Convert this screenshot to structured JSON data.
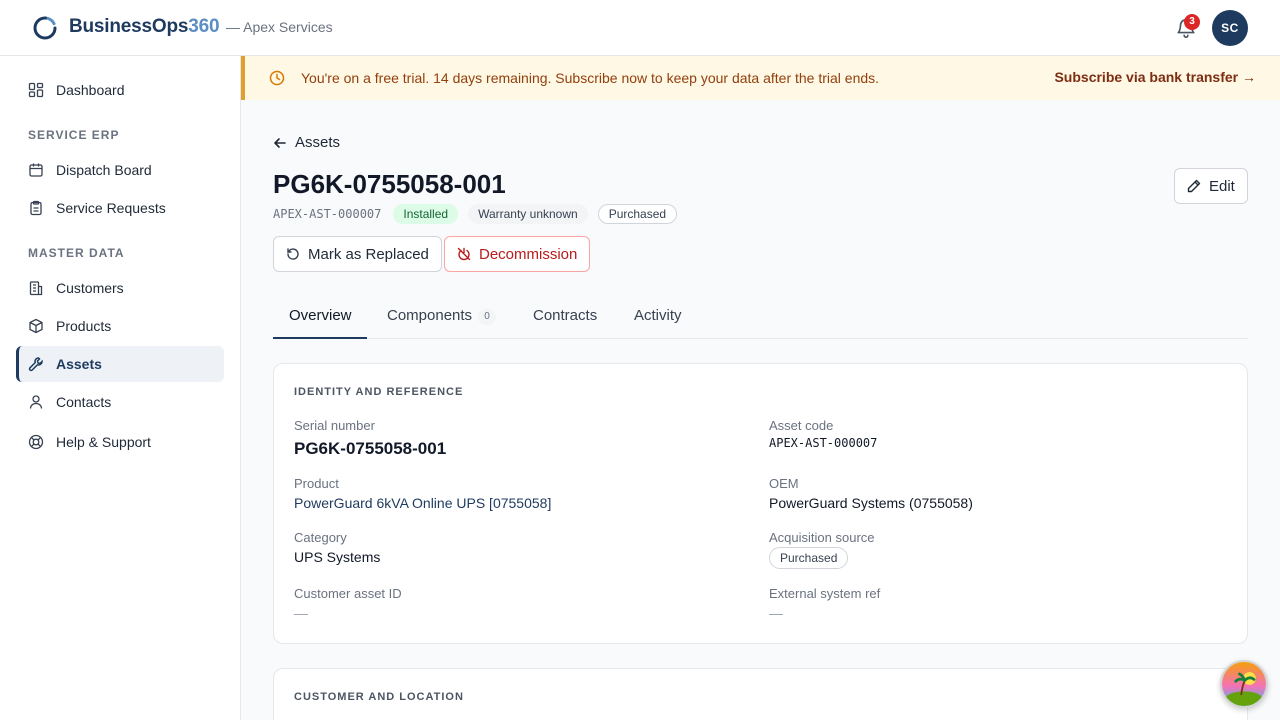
{
  "app": {
    "brand_main": "BusinessOps",
    "brand_accent": "360",
    "org": "— Apex Services"
  },
  "header": {
    "notification_count": "3",
    "avatar_initials": "SC"
  },
  "sidebar": {
    "dashboard": "Dashboard",
    "section_service": "SERVICE ERP",
    "dispatch": "Dispatch Board",
    "service_requests": "Service Requests",
    "section_master": "MASTER DATA",
    "customers": "Customers",
    "products": "Products",
    "assets": "Assets",
    "contacts": "Contacts",
    "help": "Help & Support"
  },
  "banner": {
    "text": "You're on a free trial. 14 days remaining. Subscribe now to keep your data after the trial ends.",
    "link": "Subscribe via bank transfer →"
  },
  "page": {
    "back_label": "Assets",
    "title": "PG6K-0755058-001",
    "asset_code": "APEX-AST-000007",
    "status": "Installed",
    "warranty": "Warranty unknown",
    "acquisition": "Purchased",
    "edit_label": "Edit",
    "replace_label": "Mark as Replaced",
    "decommission_label": "Decommission"
  },
  "tabs": {
    "overview": "Overview",
    "components": "Components",
    "components_count": "0",
    "contracts": "Contracts",
    "activity": "Activity"
  },
  "identity": {
    "title": "IDENTITY AND REFERENCE",
    "serial_label": "Serial number",
    "serial_value": "PG6K-0755058-001",
    "asset_code_label": "Asset code",
    "asset_code_value": "APEX-AST-000007",
    "product_label": "Product",
    "product_value": "PowerGuard 6kVA Online UPS [0755058]",
    "oem_label": "OEM",
    "oem_value": "PowerGuard Systems (0755058)",
    "category_label": "Category",
    "category_value": "UPS Systems",
    "acq_label": "Acquisition source",
    "acq_value": "Purchased",
    "cust_asset_label": "Customer asset ID",
    "cust_asset_value": "—",
    "ext_ref_label": "External system ref",
    "ext_ref_value": "—"
  },
  "location": {
    "title": "CUSTOMER AND LOCATION"
  },
  "colors": {
    "brand": "#1e3a5f",
    "accent": "#5b8ec4",
    "banner_bg": "#fef8e4",
    "danger": "#b91c1c",
    "success_bg": "#dcfce7"
  }
}
